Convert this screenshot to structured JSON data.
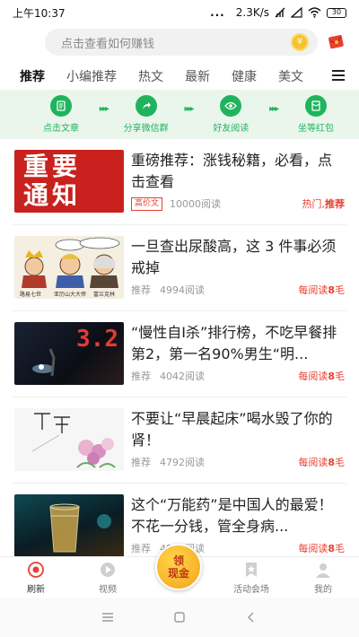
{
  "status": {
    "time": "上午10:37",
    "dots": "...",
    "speed": "2.3K/s",
    "battery": "30"
  },
  "search": {
    "placeholder": "点击查看如何赚钱"
  },
  "tabs": [
    {
      "label": "推荐",
      "active": true
    },
    {
      "label": "小编推荐",
      "active": false
    },
    {
      "label": "热文",
      "active": false
    },
    {
      "label": "最新",
      "active": false
    },
    {
      "label": "健康",
      "active": false
    },
    {
      "label": "美文",
      "active": false
    }
  ],
  "steps": [
    {
      "label": "点击文章",
      "icon": "document-icon"
    },
    {
      "label": "分享微信群",
      "icon": "share-icon"
    },
    {
      "label": "好友阅读",
      "icon": "eye-icon"
    },
    {
      "label": "坐等红包",
      "icon": "red-packet-icon"
    }
  ],
  "articles": [
    {
      "title": "重磅推荐：涨钱秘籍，必看，点击查看",
      "badge": "高价文",
      "reads": "10000阅读",
      "reward_prefix": "热门,",
      "reward_highlight": "推荐",
      "reward_suffix": "",
      "thumb_text_1": "重要",
      "thumb_text_2": "通知"
    },
    {
      "title": "一旦查出尿酸高，这 3 件事必须戒掉",
      "source": "推荐",
      "reads": "4994阅读",
      "reward_prefix": "每阅读",
      "reward_highlight": "8",
      "reward_suffix": "毛",
      "thumb_caption_1": "路易七世",
      "thumb_caption_2": "亚历山大大帝",
      "thumb_caption_3": "富兰克林"
    },
    {
      "title": "“慢性自I杀”排行榜，不吃早餐排第2，第一名90%男生“明...",
      "source": "推荐",
      "reads": "4042阅读",
      "reward_prefix": "每阅读",
      "reward_highlight": "8",
      "reward_suffix": "毛",
      "thumb_number": "3.2"
    },
    {
      "title": "不要让“早晨起床”喝水毁了你的肾！",
      "source": "推荐",
      "reads": "4792阅读",
      "reward_prefix": "每阅读",
      "reward_highlight": "8",
      "reward_suffix": "毛"
    },
    {
      "title": "这个“万能药”是中国人的最爱！不花一分钱，管全身病...",
      "source": "推荐",
      "reads": "4957阅读",
      "reward_prefix": "每阅读",
      "reward_highlight": "8",
      "reward_suffix": "毛"
    }
  ],
  "bottom_nav": [
    {
      "label": "刷新",
      "icon": "refresh-icon",
      "active": true
    },
    {
      "label": "视频",
      "icon": "play-icon",
      "active": false
    },
    {
      "label": "活动会场",
      "icon": "star-bookmark-icon",
      "active": false
    },
    {
      "label": "我的",
      "icon": "user-icon",
      "active": false
    }
  ],
  "center_button": {
    "line1": "领",
    "line2": "现金"
  },
  "colors": {
    "accent_red": "#e8402f",
    "green": "#1fb45c",
    "banner_bg": "#eaf6ec",
    "coin": "#f6c231"
  }
}
